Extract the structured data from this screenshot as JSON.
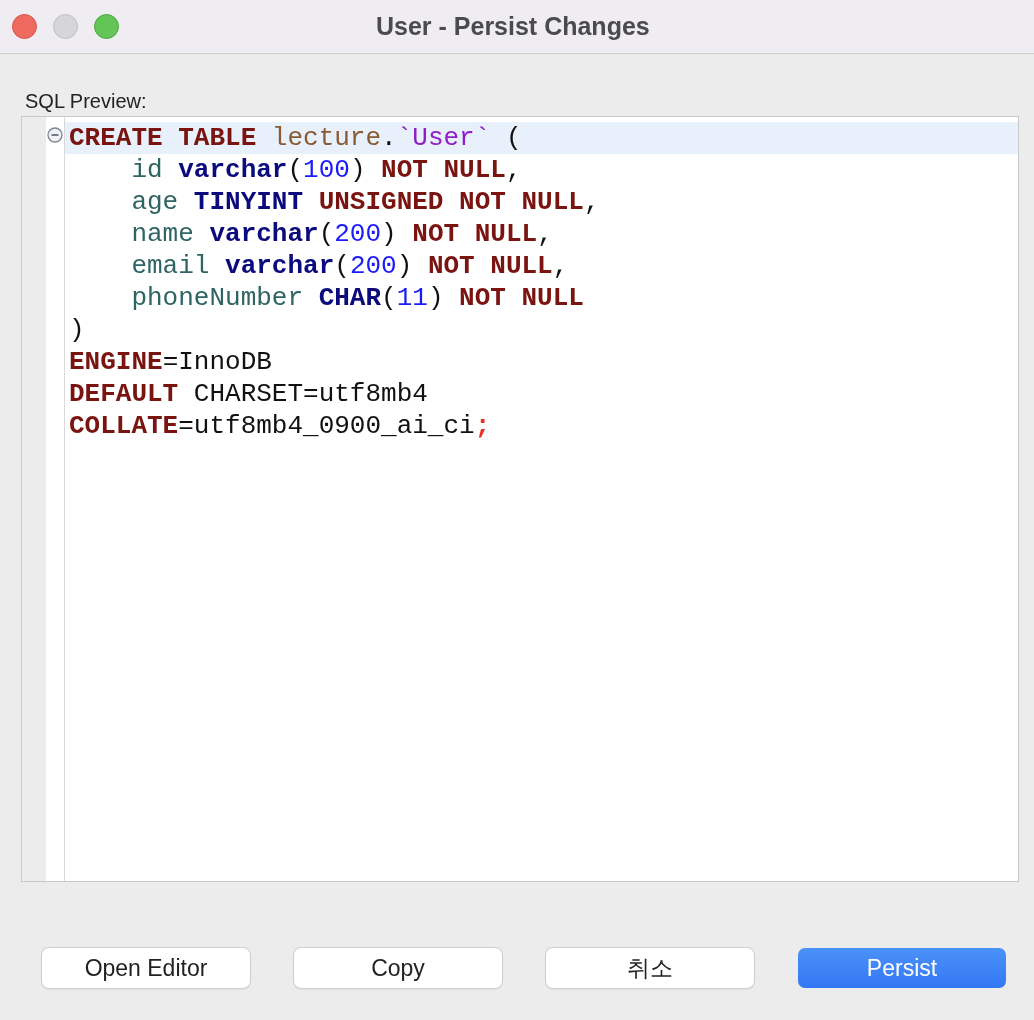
{
  "window": {
    "title": "User - Persist Changes"
  },
  "label": "SQL Preview:",
  "editor": {
    "lines": [
      {
        "current": true,
        "expanded": true,
        "tokens": [
          {
            "text": "CREATE TABLE",
            "kind": "keyword"
          },
          {
            "text": " lecture",
            "kind": "schema"
          },
          {
            "text": ".",
            "kind": "plain"
          },
          {
            "text": "`User`",
            "kind": "quoted"
          },
          {
            "text": " (",
            "kind": "plain"
          }
        ]
      },
      {
        "current": false,
        "tokens": [
          {
            "text": "    id",
            "kind": "column"
          },
          {
            "text": " varchar",
            "kind": "type"
          },
          {
            "text": "(",
            "kind": "plain"
          },
          {
            "text": "100",
            "kind": "number"
          },
          {
            "text": ")",
            "kind": "plain"
          },
          {
            "text": " NOT NULL",
            "kind": "keyword"
          },
          {
            "text": ",",
            "kind": "plain"
          }
        ]
      },
      {
        "current": false,
        "tokens": [
          {
            "text": "    age",
            "kind": "column"
          },
          {
            "text": " TINYINT",
            "kind": "type"
          },
          {
            "text": " UNSIGNED NOT NULL",
            "kind": "keyword"
          },
          {
            "text": ",",
            "kind": "plain"
          }
        ]
      },
      {
        "current": false,
        "tokens": [
          {
            "text": "    name",
            "kind": "column"
          },
          {
            "text": " varchar",
            "kind": "type"
          },
          {
            "text": "(",
            "kind": "plain"
          },
          {
            "text": "200",
            "kind": "number"
          },
          {
            "text": ")",
            "kind": "plain"
          },
          {
            "text": " NOT NULL",
            "kind": "keyword"
          },
          {
            "text": ",",
            "kind": "plain"
          }
        ]
      },
      {
        "current": false,
        "tokens": [
          {
            "text": "    email",
            "kind": "column"
          },
          {
            "text": " varchar",
            "kind": "type"
          },
          {
            "text": "(",
            "kind": "plain"
          },
          {
            "text": "200",
            "kind": "number"
          },
          {
            "text": ")",
            "kind": "plain"
          },
          {
            "text": " NOT NULL",
            "kind": "keyword"
          },
          {
            "text": ",",
            "kind": "plain"
          }
        ]
      },
      {
        "current": false,
        "tokens": [
          {
            "text": "    phoneNumber",
            "kind": "column"
          },
          {
            "text": " CHAR",
            "kind": "type"
          },
          {
            "text": "(",
            "kind": "plain"
          },
          {
            "text": "11",
            "kind": "number"
          },
          {
            "text": ")",
            "kind": "plain"
          },
          {
            "text": " NOT NULL",
            "kind": "keyword"
          }
        ]
      },
      {
        "current": false,
        "tokens": [
          {
            "text": ")",
            "kind": "plain"
          }
        ]
      },
      {
        "current": false,
        "tokens": [
          {
            "text": "ENGINE",
            "kind": "keyword"
          },
          {
            "text": "=InnoDB",
            "kind": "plain"
          }
        ]
      },
      {
        "current": false,
        "tokens": [
          {
            "text": "DEFAULT",
            "kind": "keyword"
          },
          {
            "text": " CHARSET=utf8mb4",
            "kind": "plain"
          }
        ]
      },
      {
        "current": false,
        "tokens": [
          {
            "text": "COLLATE",
            "kind": "keyword"
          },
          {
            "text": "=utf8mb4_0900_ai_ci",
            "kind": "plain"
          },
          {
            "text": ";",
            "kind": "terminator"
          }
        ]
      }
    ]
  },
  "buttons": [
    {
      "label": "Open Editor",
      "kind": "default"
    },
    {
      "label": "Copy",
      "kind": "default"
    },
    {
      "label": "취소",
      "kind": "default"
    },
    {
      "label": "Persist",
      "kind": "primary"
    }
  ]
}
